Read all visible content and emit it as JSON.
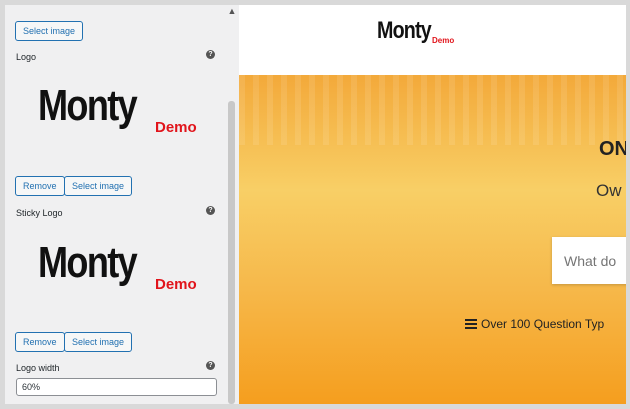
{
  "sidebar": {
    "top_select_label": "Select image",
    "logo": {
      "label": "Logo",
      "preview_text": "Monty",
      "preview_badge": "Demo",
      "remove_label": "Remove",
      "select_label": "Select image"
    },
    "sticky_logo": {
      "label": "Sticky Logo",
      "preview_text": "Monty",
      "preview_badge": "Demo",
      "remove_label": "Remove",
      "select_label": "Select image"
    },
    "logo_width": {
      "label": "Logo width",
      "value": "60%"
    },
    "help_glyph": "?"
  },
  "preview": {
    "header_logo": "Monty",
    "header_logo_badge": "Demo",
    "hero_title": "ON",
    "hero_subtitle": "Ow",
    "search_placeholder": "What do",
    "feature_text": "Over 100 Question Typ"
  },
  "colors": {
    "accent": "#2271b1",
    "demo_red": "#e1141b",
    "hero_orange": "#f59e1e"
  }
}
